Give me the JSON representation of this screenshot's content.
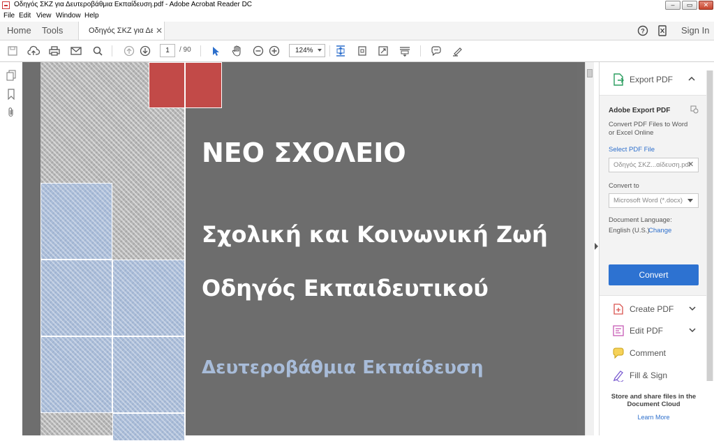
{
  "window": {
    "title": "Οδηγός ΣΚΖ για Δευτεροβάθμια Εκπαίδευση.pdf - Adobe Acrobat Reader DC",
    "minimize": "–",
    "maximize": "▭",
    "close": "✕"
  },
  "menu": [
    "File",
    "Edit",
    "View",
    "Window",
    "Help"
  ],
  "tabs": {
    "home": "Home",
    "tools": "Tools",
    "document": "Οδηγός ΣΚΖ για Δε...",
    "sign_in": "Sign In"
  },
  "toolbar": {
    "page_current": "1",
    "page_total": "/ 90",
    "zoom": "124%"
  },
  "cover": {
    "title": "ΝΕΟ ΣΧΟΛΕΙΟ",
    "line1": "Σχολική και Κοινωνική Ζωή",
    "line2": "Οδηγός Εκπαιδευτικού",
    "subtitle": "Δευτεροβάθμια Εκπαίδευση"
  },
  "right_pane": {
    "export_label": "Export PDF",
    "heading": "Adobe Export PDF",
    "desc_line1": "Convert PDF Files to Word",
    "desc_line2": "or Excel Online",
    "select_file": "Select PDF File",
    "file_value": "Οδηγός ΣΚΖ...αίδευση.pdf",
    "convert_to": "Convert to",
    "format_value": "Microsoft Word (*.docx)",
    "doc_language": "Document Language:",
    "language_value": "English (U.S.)",
    "change": "Change",
    "convert_button": "Convert",
    "tools": [
      "Create PDF",
      "Edit PDF",
      "Comment",
      "Fill & Sign"
    ],
    "cloud_line1": "Store and share files in the",
    "cloud_line2": "Document Cloud",
    "learn_more": "Learn More"
  },
  "colors": {
    "accent_blue": "#2d72d1",
    "cover_gray": "#6d6d6d",
    "cover_red": "#c24a48",
    "cover_blue": "#a9bcd8"
  }
}
